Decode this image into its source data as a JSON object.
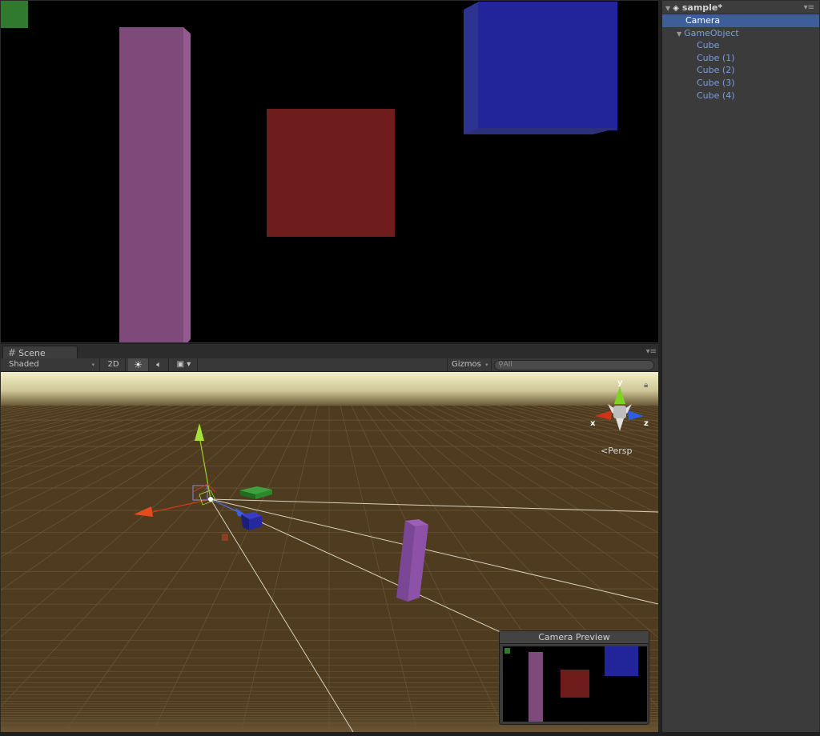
{
  "scene_panel": {
    "tab_label": "Scene",
    "toolbar": {
      "draw_mode": "Shaded",
      "mode_2d": "2D",
      "gizmos_label": "Gizmos",
      "search_placeholder": "All"
    },
    "gizmo_axes": {
      "x": "x",
      "y": "y",
      "z": "z"
    },
    "projection_label": "Persp"
  },
  "camera_preview": {
    "title": "Camera Preview"
  },
  "hierarchy": {
    "scene_name": "sample*",
    "items": [
      {
        "label": "Camera",
        "selected": true,
        "indent": 1,
        "expandable": false
      },
      {
        "label": "GameObject",
        "selected": false,
        "indent": 1,
        "expandable": true
      },
      {
        "label": "Cube",
        "selected": false,
        "indent": 2,
        "expandable": false
      },
      {
        "label": "Cube (1)",
        "selected": false,
        "indent": 2,
        "expandable": false
      },
      {
        "label": "Cube (2)",
        "selected": false,
        "indent": 2,
        "expandable": false
      },
      {
        "label": "Cube (3)",
        "selected": false,
        "indent": 2,
        "expandable": false
      },
      {
        "label": "Cube (4)",
        "selected": false,
        "indent": 2,
        "expandable": false
      }
    ]
  },
  "colors": {
    "selection": "#3e5e9a",
    "hierarchy_text": "#7b9ee0",
    "cube_purple": "#7d4a7a",
    "cube_red": "#6e1c1c",
    "cube_blue": "#22259a",
    "cube_green": "#2f7a2f",
    "ground": "#4f3c20",
    "sky": "#e8e3b8"
  }
}
